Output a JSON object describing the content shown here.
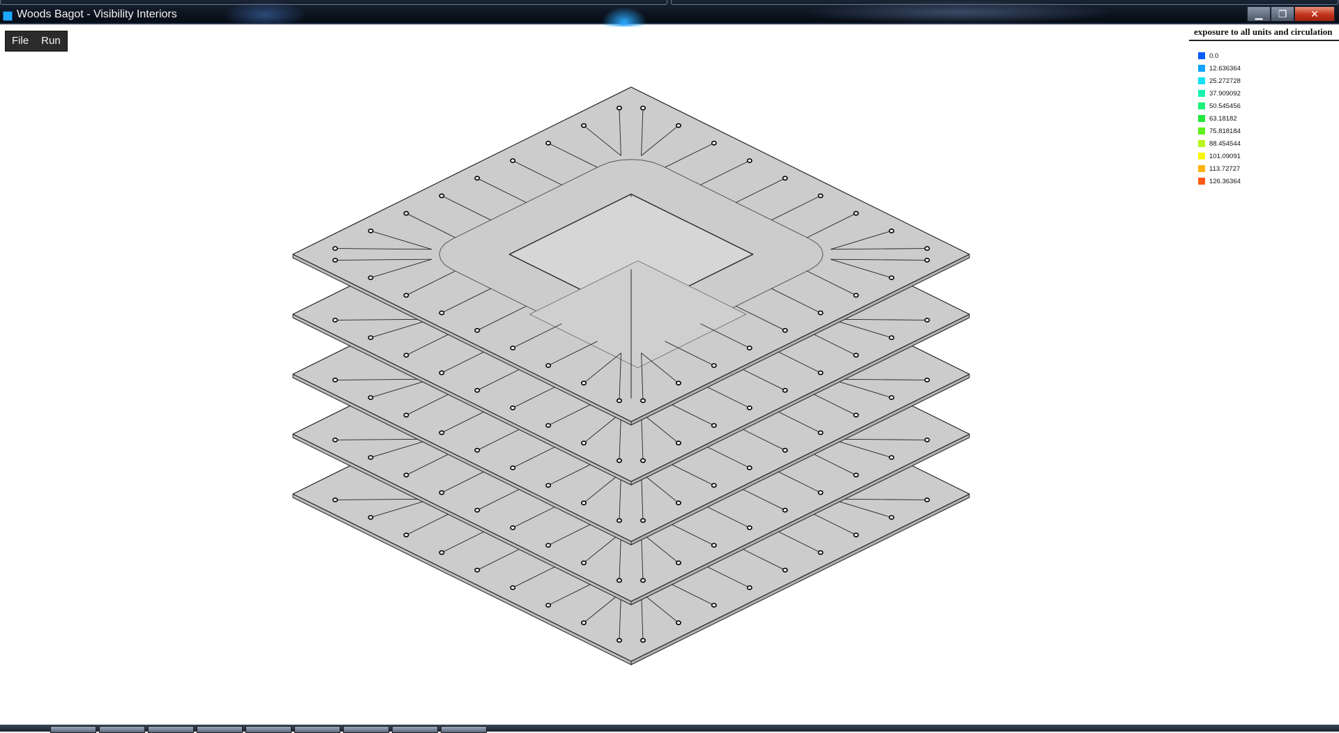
{
  "window": {
    "title": "Woods Bagot - Visibility Interiors",
    "buttons": {
      "minimize": "▁",
      "maximize": "❐",
      "close": "✕"
    }
  },
  "menu": {
    "items": [
      "File",
      "Run"
    ]
  },
  "legend": {
    "title": "exposure to all units and circulation",
    "entries": [
      {
        "label": "0.0",
        "color": "#0b5cff"
      },
      {
        "label": "12.636364",
        "color": "#10a3ff"
      },
      {
        "label": "25.272728",
        "color": "#12e2f2"
      },
      {
        "label": "37.909092",
        "color": "#18f2b2"
      },
      {
        "label": "50.545456",
        "color": "#1ef07a"
      },
      {
        "label": "63.18182",
        "color": "#22e83a"
      },
      {
        "label": "75.818184",
        "color": "#5ff21a"
      },
      {
        "label": "88.454544",
        "color": "#b8f51a"
      },
      {
        "label": "101.09091",
        "color": "#f7f50f"
      },
      {
        "label": "113.72727",
        "color": "#ffb30f"
      },
      {
        "label": "126.36364",
        "color": "#ff5a14"
      }
    ]
  },
  "model": {
    "floor_count": 5,
    "slab_color": "#cccccc",
    "edge_color": "#222222",
    "units_per_side": 9
  },
  "taskbar": {
    "button_count": 9
  }
}
